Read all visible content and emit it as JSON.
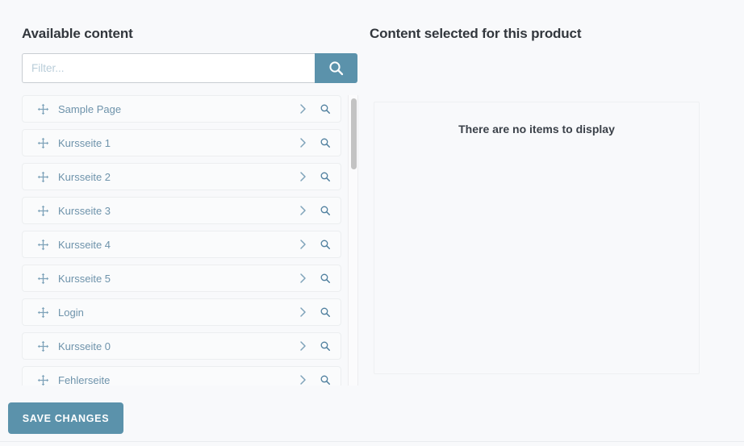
{
  "available": {
    "title": "Available content",
    "filter": {
      "placeholder": "Filter...",
      "value": "",
      "search_icon": "search-icon"
    },
    "items": [
      {
        "label": "Sample Page",
        "drag_icon": "move-icon",
        "expand_icon": "chevron-right-icon",
        "preview_icon": "magnifier-icon"
      },
      {
        "label": "Kursseite 1",
        "drag_icon": "move-icon",
        "expand_icon": "chevron-right-icon",
        "preview_icon": "magnifier-icon"
      },
      {
        "label": "Kursseite 2",
        "drag_icon": "move-icon",
        "expand_icon": "chevron-right-icon",
        "preview_icon": "magnifier-icon"
      },
      {
        "label": "Kursseite 3",
        "drag_icon": "move-icon",
        "expand_icon": "chevron-right-icon",
        "preview_icon": "magnifier-icon"
      },
      {
        "label": "Kursseite 4",
        "drag_icon": "move-icon",
        "expand_icon": "chevron-right-icon",
        "preview_icon": "magnifier-icon"
      },
      {
        "label": "Kursseite 5",
        "drag_icon": "move-icon",
        "expand_icon": "chevron-right-icon",
        "preview_icon": "magnifier-icon"
      },
      {
        "label": "Login",
        "drag_icon": "move-icon",
        "expand_icon": "chevron-right-icon",
        "preview_icon": "magnifier-icon"
      },
      {
        "label": "Kursseite 0",
        "drag_icon": "move-icon",
        "expand_icon": "chevron-right-icon",
        "preview_icon": "magnifier-icon"
      },
      {
        "label": "Fehlerseite",
        "drag_icon": "move-icon",
        "expand_icon": "chevron-right-icon",
        "preview_icon": "magnifier-icon"
      }
    ]
  },
  "selected": {
    "title": "Content selected for this product",
    "empty_message": "There are no items to display"
  },
  "footer": {
    "save_label": "SAVE CHANGES"
  },
  "colors": {
    "accent": "#5b92ab",
    "page_background": "#f8f9fb",
    "item_text": "#6e93ab",
    "heading": "#32373d",
    "scrollbar_thumb": "#c3c3c3"
  }
}
